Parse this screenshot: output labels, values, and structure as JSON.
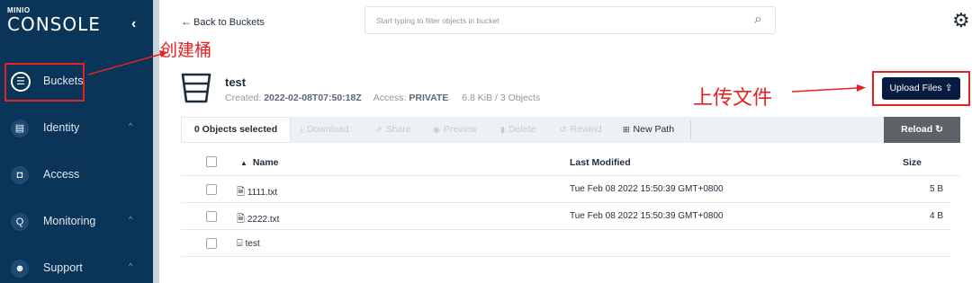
{
  "logo": {
    "brand": "MINIO",
    "product": "CONSOLE"
  },
  "sidebar": {
    "collapse_icon": "chevron-left-icon",
    "items": [
      {
        "label": "Buckets",
        "icon": "bucket-icon"
      },
      {
        "label": "Identity",
        "icon": "id-card-icon"
      },
      {
        "label": "Access",
        "icon": "lock-icon"
      },
      {
        "label": "Monitoring",
        "icon": "magnifier-icon"
      },
      {
        "label": "Support",
        "icon": "support-icon"
      }
    ]
  },
  "topbar": {
    "back_label": "Back to Buckets",
    "search_placeholder": "Start typing to filter objects in bucket",
    "settings_icon": "gear-icon"
  },
  "annotations": {
    "create_bucket": "创建桶",
    "upload_files": "上传文件"
  },
  "bucket": {
    "name": "test",
    "created_label": "Created:",
    "created_value": "2022-02-08T07:50:18Z",
    "access_label": "Access:",
    "access_value": "PRIVATE",
    "size": "6.8 KiB / 3 Objects"
  },
  "upload_label": "Upload Files",
  "toolbar": {
    "selected": "0 Objects selected",
    "download": "Download",
    "share": "Share",
    "preview": "Preview",
    "delete": "Delete",
    "rewind": "Rewind",
    "new_path": "New Path",
    "reload": "Reload"
  },
  "table": {
    "columns": {
      "name": "Name",
      "last_modified": "Last Modified",
      "size": "Size"
    },
    "rows": [
      {
        "name": "1111.txt",
        "last_modified": "Tue Feb 08 2022 15:50:39 GMT+0800",
        "size": "5 B",
        "type": "file"
      },
      {
        "name": "2222.txt",
        "last_modified": "Tue Feb 08 2022 15:50:39 GMT+0800",
        "size": "4 B",
        "type": "file"
      },
      {
        "name": "test",
        "last_modified": "",
        "size": "",
        "type": "folder"
      }
    ]
  },
  "colors": {
    "sidebar_bg": "#0b3558",
    "annotation_red": "#e52222",
    "upload_bg": "#081c42",
    "reload_bg": "#5d6268"
  }
}
